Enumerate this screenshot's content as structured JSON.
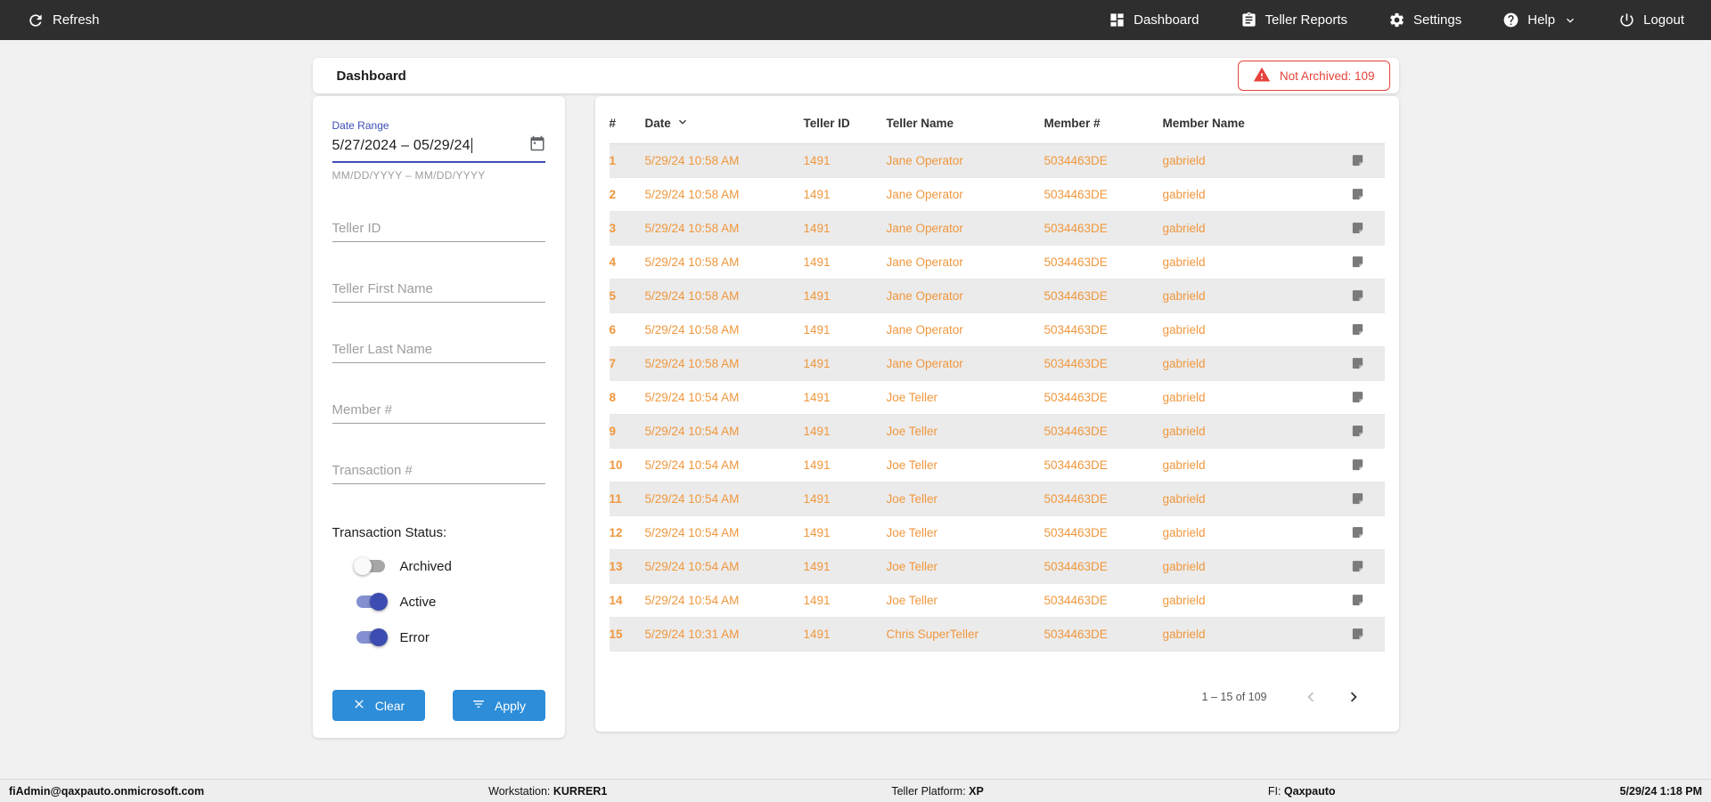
{
  "topbar": {
    "refresh_label": "Refresh",
    "items": [
      {
        "label": "Dashboard",
        "icon": "dashboard-grid-icon"
      },
      {
        "label": "Teller Reports",
        "icon": "clipboard-icon"
      },
      {
        "label": "Settings",
        "icon": "gear-icon"
      },
      {
        "label": "Help",
        "icon": "help-circle-icon"
      },
      {
        "label": "Logout",
        "icon": "power-icon"
      }
    ]
  },
  "header": {
    "title": "Dashboard",
    "alert_text": "Not Archived: 109"
  },
  "filters": {
    "date_range": {
      "label": "Date Range",
      "value": "5/27/2024 – 05/29/24",
      "helper": "MM/DD/YYYY – MM/DD/YYYY"
    },
    "fields": [
      {
        "placeholder": "Teller ID"
      },
      {
        "placeholder": "Teller First Name"
      },
      {
        "placeholder": "Teller Last Name"
      },
      {
        "placeholder": "Member #"
      },
      {
        "placeholder": "Transaction #"
      }
    ],
    "status": {
      "label": "Transaction Status:",
      "toggles": [
        {
          "label": "Archived",
          "on": false
        },
        {
          "label": "Active",
          "on": true
        },
        {
          "label": "Error",
          "on": true
        }
      ]
    },
    "clear_label": "Clear",
    "apply_label": "Apply"
  },
  "table": {
    "columns": [
      "#",
      "Date",
      "Teller ID",
      "Teller Name",
      "Member #",
      "Member Name"
    ],
    "sorted_column": "Date",
    "rows": [
      {
        "num": "1",
        "date": "5/29/24 10:58 AM",
        "teller_id": "1491",
        "teller_name": "Jane Operator",
        "member_num": "5034463DE",
        "member_name": "gabrield"
      },
      {
        "num": "2",
        "date": "5/29/24 10:58 AM",
        "teller_id": "1491",
        "teller_name": "Jane Operator",
        "member_num": "5034463DE",
        "member_name": "gabrield"
      },
      {
        "num": "3",
        "date": "5/29/24 10:58 AM",
        "teller_id": "1491",
        "teller_name": "Jane Operator",
        "member_num": "5034463DE",
        "member_name": "gabrield"
      },
      {
        "num": "4",
        "date": "5/29/24 10:58 AM",
        "teller_id": "1491",
        "teller_name": "Jane Operator",
        "member_num": "5034463DE",
        "member_name": "gabrield"
      },
      {
        "num": "5",
        "date": "5/29/24 10:58 AM",
        "teller_id": "1491",
        "teller_name": "Jane Operator",
        "member_num": "5034463DE",
        "member_name": "gabrield"
      },
      {
        "num": "6",
        "date": "5/29/24 10:58 AM",
        "teller_id": "1491",
        "teller_name": "Jane Operator",
        "member_num": "5034463DE",
        "member_name": "gabrield"
      },
      {
        "num": "7",
        "date": "5/29/24 10:58 AM",
        "teller_id": "1491",
        "teller_name": "Jane Operator",
        "member_num": "5034463DE",
        "member_name": "gabrield"
      },
      {
        "num": "8",
        "date": "5/29/24 10:54 AM",
        "teller_id": "1491",
        "teller_name": "Joe Teller",
        "member_num": "5034463DE",
        "member_name": "gabrield"
      },
      {
        "num": "9",
        "date": "5/29/24 10:54 AM",
        "teller_id": "1491",
        "teller_name": "Joe Teller",
        "member_num": "5034463DE",
        "member_name": "gabrield"
      },
      {
        "num": "10",
        "date": "5/29/24 10:54 AM",
        "teller_id": "1491",
        "teller_name": "Joe Teller",
        "member_num": "5034463DE",
        "member_name": "gabrield"
      },
      {
        "num": "11",
        "date": "5/29/24 10:54 AM",
        "teller_id": "1491",
        "teller_name": "Joe Teller",
        "member_num": "5034463DE",
        "member_name": "gabrield"
      },
      {
        "num": "12",
        "date": "5/29/24 10:54 AM",
        "teller_id": "1491",
        "teller_name": "Joe Teller",
        "member_num": "5034463DE",
        "member_name": "gabrield"
      },
      {
        "num": "13",
        "date": "5/29/24 10:54 AM",
        "teller_id": "1491",
        "teller_name": "Joe Teller",
        "member_num": "5034463DE",
        "member_name": "gabrield"
      },
      {
        "num": "14",
        "date": "5/29/24 10:54 AM",
        "teller_id": "1491",
        "teller_name": "Joe Teller",
        "member_num": "5034463DE",
        "member_name": "gabrield"
      },
      {
        "num": "15",
        "date": "5/29/24 10:31 AM",
        "teller_id": "1491",
        "teller_name": "Chris SuperTeller",
        "member_num": "5034463DE",
        "member_name": "gabrield"
      }
    ],
    "pagination": {
      "range_text": "1 – 15 of 109"
    }
  },
  "footer": {
    "user": "fiAdmin@qaxpauto.onmicrosoft.com",
    "workstation_label": "Workstation:",
    "workstation_value": "KURRER1",
    "platform_label": "Teller Platform:",
    "platform_value": "XP",
    "fi_label": "FI:",
    "fi_value": "Qaxpauto",
    "datetime": "5/29/24 1:18 PM"
  },
  "colors": {
    "topbar_bg": "#2e2e2e",
    "accent_blue": "#2d8dd8",
    "toggle_indigo": "#3c4cb0",
    "field_indigo": "#3d4db7",
    "alert_red": "#e5433b",
    "row_text_orange": "#f0973d",
    "row_alt_bg": "#ebebeb"
  }
}
